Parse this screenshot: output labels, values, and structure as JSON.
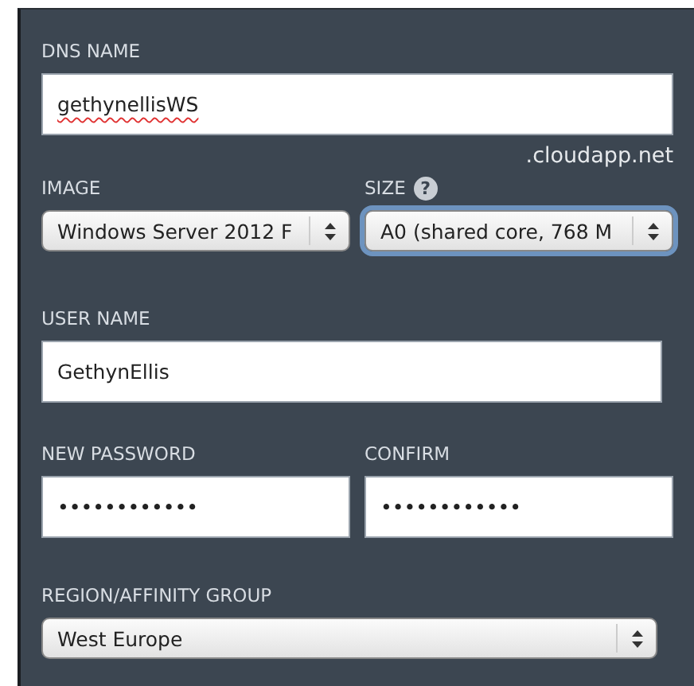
{
  "dns_name": {
    "label": "DNS NAME",
    "value": "gethynellisWS",
    "spellcheck_error": true,
    "suffix": ".cloudapp.net"
  },
  "image": {
    "label": "IMAGE",
    "value": "Windows Server 2012 F",
    "focused": false
  },
  "size": {
    "label": "SIZE",
    "help": "?",
    "value": "A0 (shared core, 768 M",
    "focused": true
  },
  "user_name": {
    "label": "USER NAME",
    "value": "GethynEllis"
  },
  "new_password": {
    "label": "NEW PASSWORD",
    "value": "••••••••••••"
  },
  "confirm": {
    "label": "CONFIRM",
    "value": "••••••••••••"
  },
  "region": {
    "label": "REGION/AFFINITY GROUP",
    "value": "West Europe",
    "focused": false
  }
}
